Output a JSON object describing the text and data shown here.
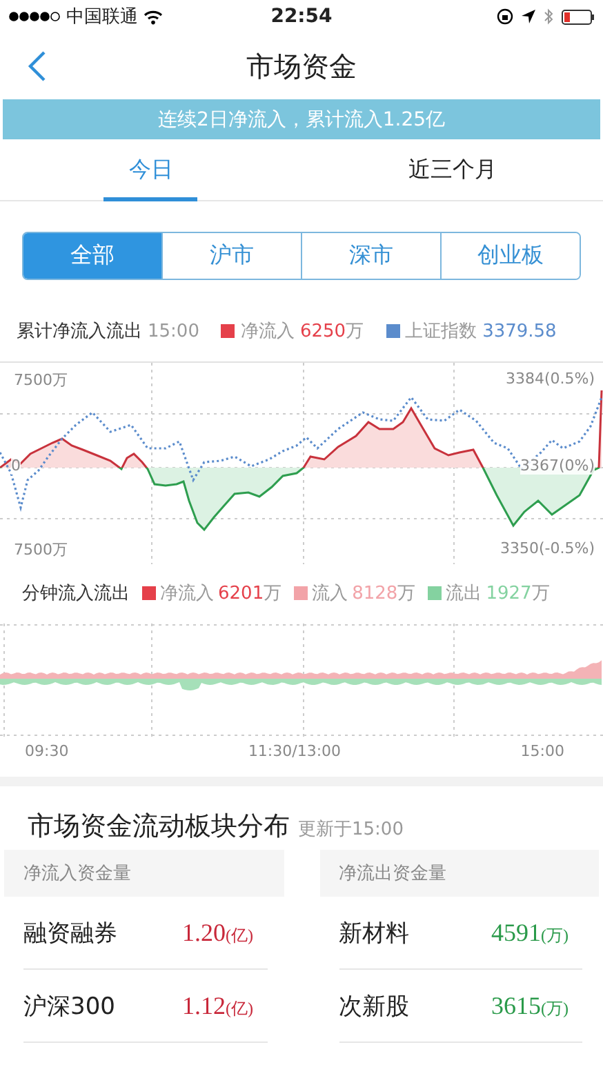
{
  "status_bar": {
    "carrier": "中国联通",
    "time": "22:54"
  },
  "nav": {
    "title": "市场资金"
  },
  "banner": "连续2日净流入，累计流入1.25亿",
  "tabs": [
    {
      "label": "今日",
      "selected": true
    },
    {
      "label": "近三个月",
      "selected": false
    }
  ],
  "segments": [
    {
      "label": "全部",
      "selected": true
    },
    {
      "label": "沪市",
      "selected": false
    },
    {
      "label": "深市",
      "selected": false
    },
    {
      "label": "创业板",
      "selected": false
    }
  ],
  "cumulative_chart": {
    "title": "累计净流入流出",
    "time": "15:00",
    "legend": [
      {
        "label": "净流入",
        "value": "6250",
        "unit": "万",
        "color": "#e5404a"
      },
      {
        "label": "上证指数",
        "value": "3379.58",
        "color": "#5b8ccc"
      }
    ],
    "left_labels": [
      "7500万",
      "0",
      "7500万"
    ],
    "right_labels": [
      "3384(0.5%)",
      "3367(0%)",
      "3350(-0.5%)"
    ]
  },
  "minute_chart": {
    "title": "分钟流入流出",
    "legend": [
      {
        "label": "净流入",
        "value": "6201",
        "unit": "万",
        "color": "#e5404a"
      },
      {
        "label": "流入",
        "value": "8128",
        "unit": "万",
        "color": "#f2a3a8"
      },
      {
        "label": "流出",
        "value": "1927",
        "unit": "万",
        "color": "#84d2a0"
      }
    ],
    "x_labels": [
      "09:30",
      "11:30/13:00",
      "15:00"
    ]
  },
  "sector": {
    "title": "市场资金流动板块分布",
    "updated": "更新于15:00",
    "columns": [
      {
        "heading": "净流入资金量",
        "kind": "inflow",
        "rows": [
          {
            "name": "融资融券",
            "value": "1.20",
            "unit": "(亿)"
          },
          {
            "name": "沪深300",
            "value": "1.12",
            "unit": "(亿)"
          }
        ]
      },
      {
        "heading": "净流出资金量",
        "kind": "outflow",
        "rows": [
          {
            "name": "新材料",
            "value": "4591",
            "unit": "(万)"
          },
          {
            "name": "次新股",
            "value": "3615",
            "unit": "(万)"
          }
        ]
      }
    ]
  }
}
